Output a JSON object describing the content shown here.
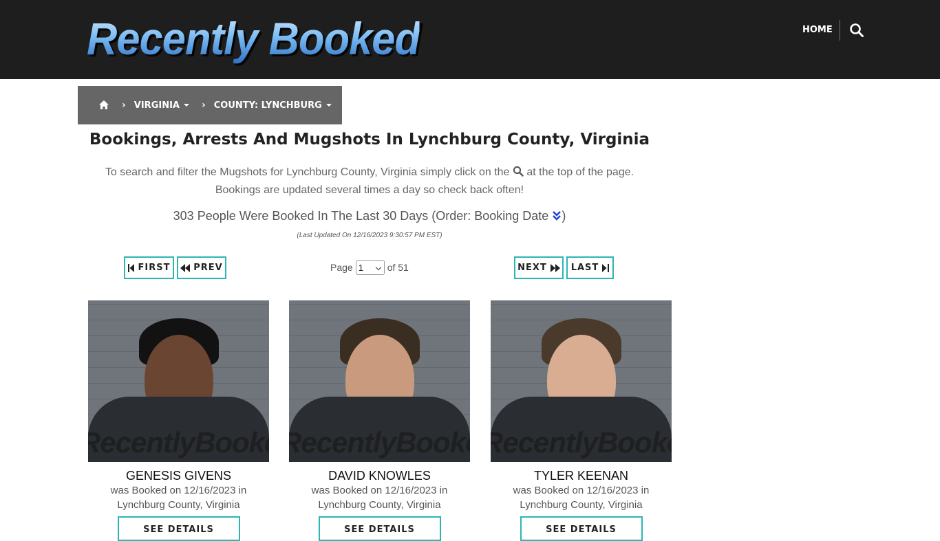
{
  "header": {
    "logo_text": "Recently Booked",
    "nav_home": "HOME",
    "search_icon": "search-icon"
  },
  "breadcrumb": {
    "home_icon": "home-icon",
    "items": [
      {
        "label": "VIRGINIA"
      },
      {
        "label": "COUNTY: LYNCHBURG"
      }
    ]
  },
  "main": {
    "title": "Bookings, Arrests And Mugshots In Lynchburg County, Virginia",
    "intro_part1": "To search and filter the Mugshots for Lynchburg County, Virginia simply click on the",
    "intro_part2": "at the top of the page.",
    "intro_line2": "Bookings are updated several times a day so check back often!",
    "count_text": "303 People Were Booked In The Last 30 Days (Order: Booking Date",
    "count_close": ")",
    "last_updated": "(Last Updated On 12/16/2023 9:30:57 PM EST)"
  },
  "pagination": {
    "first": "FIRST",
    "prev": "PREV",
    "page_label": "Page",
    "page_value": "1",
    "of_label": "of 51",
    "next": "NEXT",
    "last": "LAST"
  },
  "bookings": [
    {
      "name": "GENESIS GIVENS",
      "booked_line": "was Booked on 12/16/2023 in",
      "location": "Lynchburg County, Virginia",
      "button": "SEE DETAILS",
      "watermark": "RecentlyBooked.com"
    },
    {
      "name": "DAVID KNOWLES",
      "booked_line": "was Booked on 12/16/2023 in",
      "location": "Lynchburg County, Virginia",
      "button": "SEE DETAILS",
      "watermark": "RecentlyBooked.com"
    },
    {
      "name": "TYLER KEENAN",
      "booked_line": "was Booked on 12/16/2023 in",
      "location": "Lynchburg County, Virginia",
      "button": "SEE DETAILS",
      "watermark": "RecentlyBooked.com"
    }
  ],
  "colors": {
    "header_bg": "#1e1e1e",
    "breadcrumb_bg": "#666666",
    "button_border": "#2bb5b5",
    "order_icon": "#1a3fd6"
  }
}
